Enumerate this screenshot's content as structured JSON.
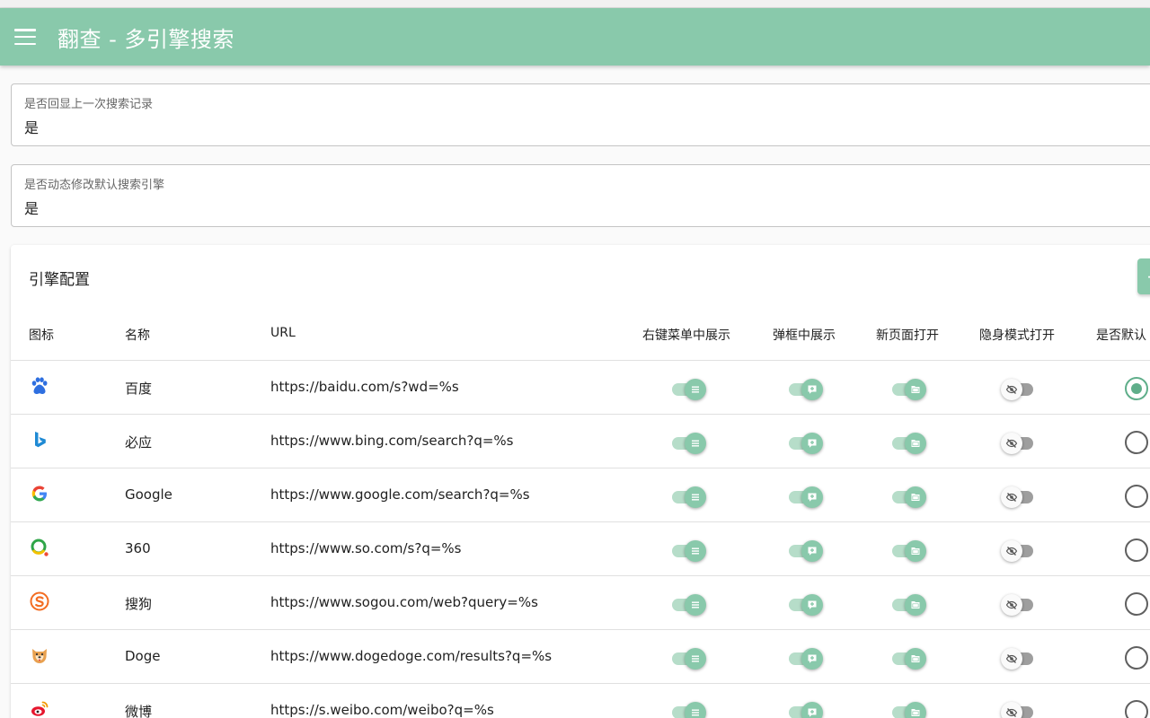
{
  "app": {
    "title": "翻查 - 多引擎搜索"
  },
  "settings": [
    {
      "label": "是否回显上一次搜索记录",
      "value": "是"
    },
    {
      "label": "是否动态修改默认搜索引擎",
      "value": "是"
    }
  ],
  "engines_card": {
    "title": "引擎配置",
    "add_label": "+",
    "columns": {
      "icon": "图标",
      "name": "名称",
      "url": "URL",
      "context_menu": "右键菜单中展示",
      "popup": "弹框中展示",
      "new_page": "新页面打开",
      "incognito": "隐身模式打开",
      "default": "是否默认"
    },
    "rows": [
      {
        "icon": "baidu-icon",
        "name": "百度",
        "url": "https://baidu.com/s?wd=%s",
        "context_menu": true,
        "popup": true,
        "new_page": true,
        "incognito": false,
        "default": true
      },
      {
        "icon": "bing-icon",
        "name": "必应",
        "url": "https://www.bing.com/search?q=%s",
        "context_menu": true,
        "popup": true,
        "new_page": true,
        "incognito": false,
        "default": false
      },
      {
        "icon": "google-icon",
        "name": "Google",
        "url": "https://www.google.com/search?q=%s",
        "context_menu": true,
        "popup": true,
        "new_page": true,
        "incognito": false,
        "default": false
      },
      {
        "icon": "360-icon",
        "name": "360",
        "url": "https://www.so.com/s?q=%s",
        "context_menu": true,
        "popup": true,
        "new_page": true,
        "incognito": false,
        "default": false
      },
      {
        "icon": "sogou-icon",
        "name": "搜狗",
        "url": "https://www.sogou.com/web?query=%s",
        "context_menu": true,
        "popup": true,
        "new_page": true,
        "incognito": false,
        "default": false
      },
      {
        "icon": "doge-icon",
        "name": "Doge",
        "url": "https://www.dogedoge.com/results?q=%s",
        "context_menu": true,
        "popup": true,
        "new_page": true,
        "incognito": false,
        "default": false
      },
      {
        "icon": "weibo-icon",
        "name": "微博",
        "url": "https://s.weibo.com/weibo?q=%s",
        "context_menu": true,
        "popup": true,
        "new_page": true,
        "incognito": false,
        "default": false
      }
    ]
  },
  "colors": {
    "primary": "#89c9ab",
    "primary_dark": "#5fae8a",
    "track_on": "#b6ddc9",
    "track_off": "#9e9e9e"
  }
}
